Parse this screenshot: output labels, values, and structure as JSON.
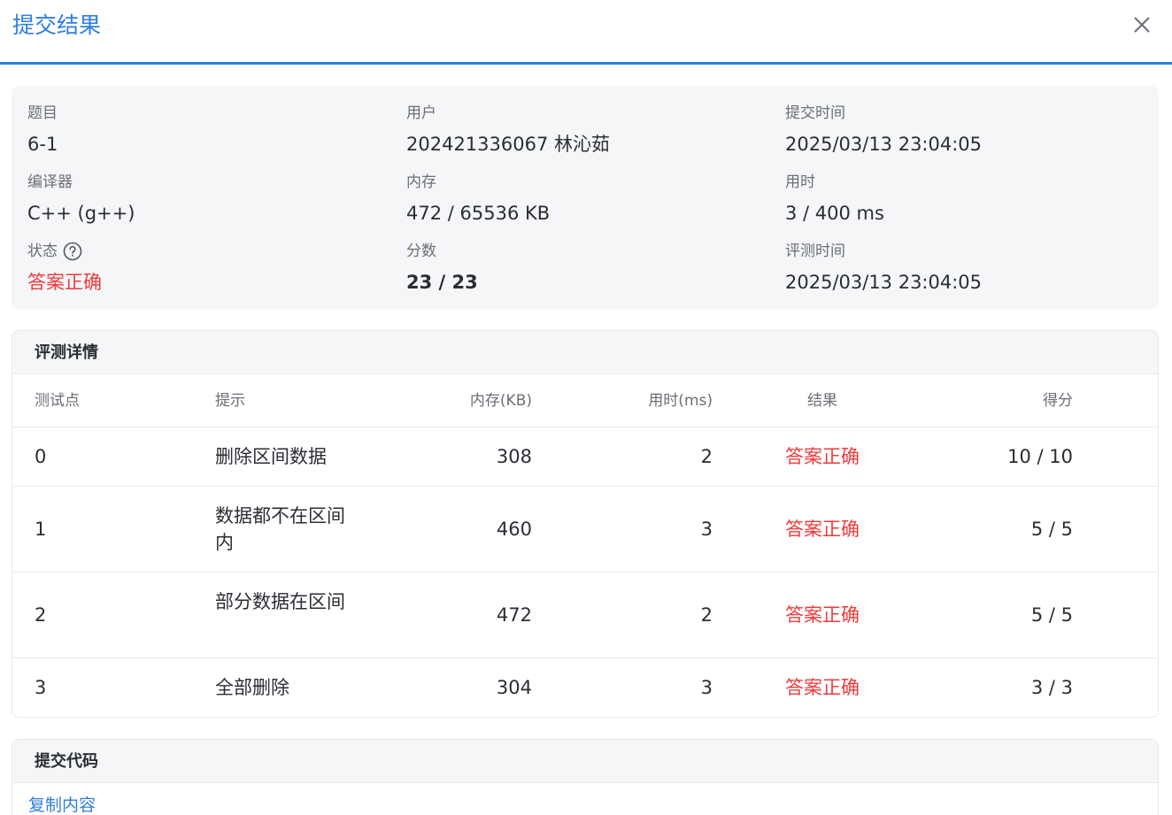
{
  "header": {
    "title": "提交结果"
  },
  "info": {
    "problem": {
      "label": "题目",
      "value": "6-1"
    },
    "user": {
      "label": "用户",
      "value": "202421336067 林沁茹"
    },
    "submit_time": {
      "label": "提交时间",
      "value": "2025/03/13 23:04:05"
    },
    "compiler": {
      "label": "编译器",
      "value": "C++ (g++)"
    },
    "memory": {
      "label": "内存",
      "value": "472 / 65536 KB"
    },
    "time_used": {
      "label": "用时",
      "value": "3 / 400 ms"
    },
    "status": {
      "label": "状态",
      "value": "答案正确"
    },
    "score": {
      "label": "分数",
      "value": "23 / 23"
    },
    "judge_time": {
      "label": "评测时间",
      "value": "2025/03/13 23:04:05"
    }
  },
  "details": {
    "title": "评测详情",
    "columns": {
      "case": "测试点",
      "hint": "提示",
      "memory": "内存(KB)",
      "time": "用时(ms)",
      "result": "结果",
      "score": "得分"
    },
    "rows": [
      {
        "case": "0",
        "hint": "删除区间数据",
        "memory": "308",
        "time": "2",
        "result": "答案正确",
        "score": "10 / 10"
      },
      {
        "case": "1",
        "hint": "数据都不在区间内",
        "memory": "460",
        "time": "3",
        "result": "答案正确",
        "score": "5 / 5"
      },
      {
        "case": "2",
        "hint": "部分数据在区间",
        "memory": "472",
        "time": "2",
        "result": "答案正确",
        "score": "5 / 5"
      },
      {
        "case": "3",
        "hint": "全部删除",
        "memory": "304",
        "time": "3",
        "result": "答案正确",
        "score": "3 / 3"
      }
    ]
  },
  "code": {
    "title": "提交代码",
    "copy_label": "复制内容"
  },
  "colors": {
    "accent": "#2f7fe0",
    "success_text": "#ef3b3b",
    "card_bg": "#f5f6f8"
  }
}
